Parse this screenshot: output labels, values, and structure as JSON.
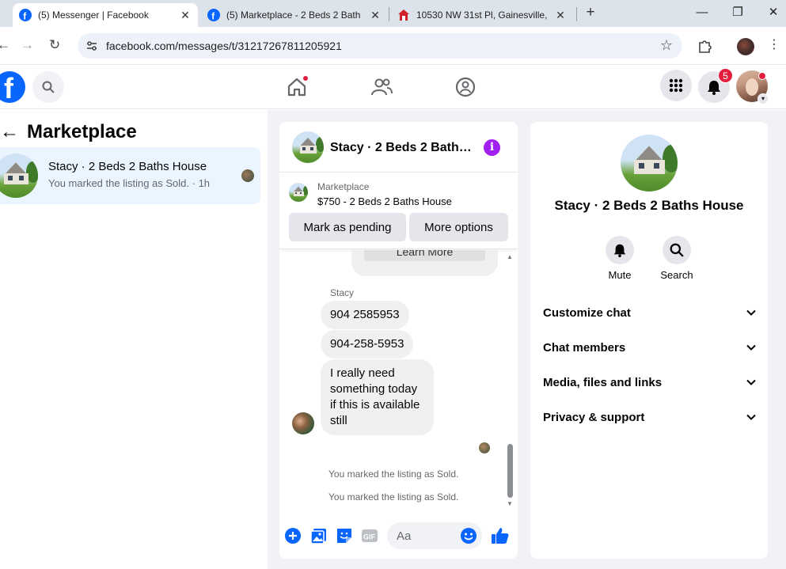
{
  "browser": {
    "tabs": [
      {
        "title": "(5) Messenger | Facebook",
        "active": true
      },
      {
        "title": "(5) Marketplace - 2 Beds 2 Bath",
        "active": false
      },
      {
        "title": "10530 NW 31st Pl, Gainesville, F",
        "active": false
      }
    ],
    "url": "facebook.com/messages/t/31217267811205921"
  },
  "fb": {
    "logo_letter": "f",
    "notification_count": "5",
    "brand_color": "#0866ff",
    "alert_color": "#e41e3f"
  },
  "left": {
    "back_arrow": "←",
    "title": "Marketplace",
    "conversation": {
      "name": "Stacy · 2 Beds 2 Baths House",
      "snippet": "You marked the listing as Sold. · 1h"
    }
  },
  "chat": {
    "header_name": "Stacy · 2 Beds 2 Bath…",
    "info_glyph": "i",
    "listing": {
      "category": "Marketplace",
      "price_title": "$750 - 2 Beds 2 Baths House",
      "mark_pending": "Mark as pending",
      "more_options": "More options"
    },
    "learn_more": "Learn More",
    "sender": "Stacy",
    "messages": [
      "904 2585953",
      "904-258-5953",
      "I really need something today if this is available still"
    ],
    "system_messages": [
      "You marked the listing as Sold.",
      "You marked the listing as Sold."
    ],
    "composer_placeholder": "Aa",
    "composer_icons": [
      "plus-icon",
      "photo-icon",
      "sticker-icon",
      "gif-icon",
      "emoji-icon",
      "like-icon"
    ],
    "gif_label": "GIF"
  },
  "info": {
    "name": "Stacy · 2 Beds 2 Baths House",
    "actions": [
      {
        "label": "Mute",
        "icon": "bell-icon"
      },
      {
        "label": "Search",
        "icon": "search-icon"
      }
    ],
    "sections": [
      "Customize chat",
      "Chat members",
      "Media, files and links",
      "Privacy & support"
    ]
  }
}
